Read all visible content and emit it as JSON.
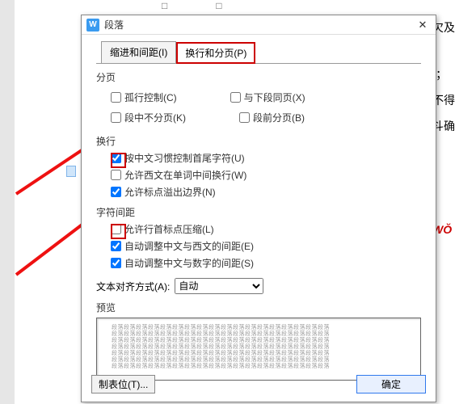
{
  "topruler": "□□",
  "dialog": {
    "title": "段落",
    "close": "✕",
    "tab_indent": "缩进和间距(I)",
    "tab_page": "换行和分页(P)"
  },
  "paging": {
    "title": "分页",
    "widow": "孤行控制(C)",
    "keepnext": "与下段同页(X)",
    "keep": "段中不分页(K)",
    "pagebreak": "段前分页(B)"
  },
  "wrap": {
    "title": "换行",
    "cn_punct": "按中文习惯控制首尾字符(U)",
    "latin_wrap": "允许西文在单词中间换行(W)",
    "punct_overflow": "允许标点溢出边界(N)"
  },
  "spacing": {
    "title": "字符间距",
    "compress": "允许行首标点压缩(L)",
    "auto_cn_en": "自动调整中文与西文的间距(E)",
    "auto_cn_num": "自动调整中文与数字的间距(S)"
  },
  "align": {
    "label": "文本对齐方式(A):",
    "value": "自动"
  },
  "preview": {
    "title": "预览",
    "line": "段落段落段落段落段落段落段落段落段落段落段落段落段落段落段落段落段落段落"
  },
  "footer": {
    "tabstops": "制表位(T)...",
    "ok": "确定"
  },
  "bg": {
    "t1": "欠及",
    "t2": "Ⅰ；",
    "t3": "不得",
    "t4": "斗确",
    "wo": "WŎ"
  }
}
